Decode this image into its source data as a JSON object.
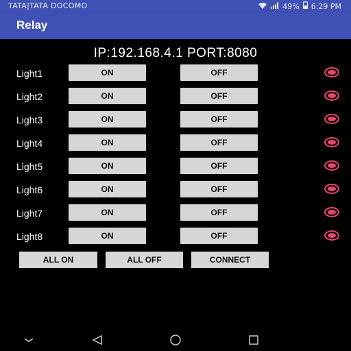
{
  "status_bar": {
    "carrier": "TATA|TATA DOCOMO",
    "battery": "49%",
    "time": "6:29 PM",
    "icons": [
      "wifi-icon",
      "signal-icon",
      "battery-icon"
    ]
  },
  "app_bar": {
    "title": "Relay"
  },
  "connection_line": "IP:192.168.4.1 PORT:8080",
  "lights": [
    {
      "label": "Light1",
      "on": "ON",
      "off": "OFF"
    },
    {
      "label": "Light2",
      "on": "ON",
      "off": "OFF"
    },
    {
      "label": "Light3",
      "on": "ON",
      "off": "OFF"
    },
    {
      "label": "Light4",
      "on": "ON",
      "off": "OFF"
    },
    {
      "label": "Light5",
      "on": "ON",
      "off": "OFF"
    },
    {
      "label": "Light6",
      "on": "ON",
      "off": "OFF"
    },
    {
      "label": "Light7",
      "on": "ON",
      "off": "OFF"
    },
    {
      "label": "Light8",
      "on": "ON",
      "off": "OFF"
    }
  ],
  "bottom_buttons": {
    "all_on": "ALL ON",
    "all_off": "ALL OFF",
    "connect": "CONNECT"
  },
  "colors": {
    "appbar": "#3f51b5",
    "indicator": "#e8456b",
    "button": "#d6d6d6",
    "background": "#000000"
  },
  "nav_icons": [
    "chevron-down-icon",
    "back-icon",
    "home-icon",
    "recents-icon"
  ]
}
